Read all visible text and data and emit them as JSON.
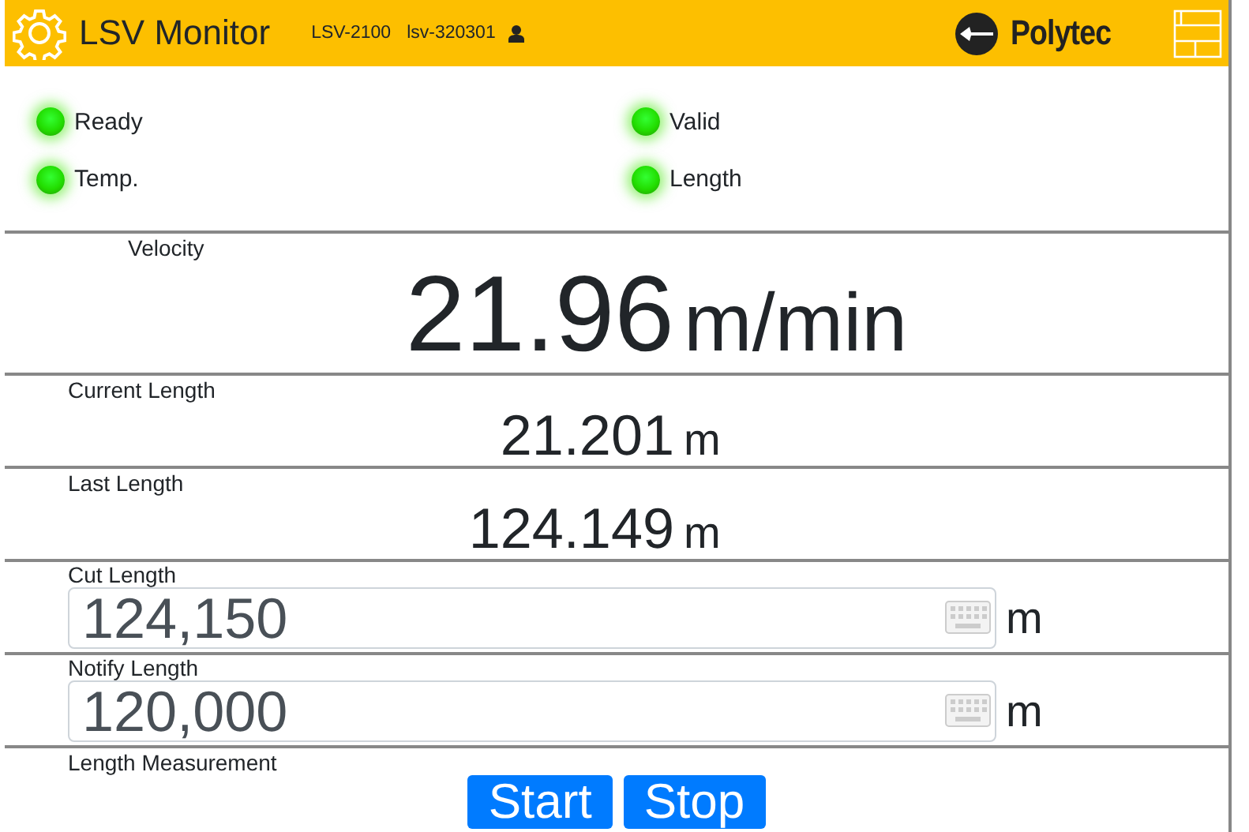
{
  "header": {
    "title": "LSV Monitor",
    "device": "LSV-2100",
    "serial": "lsv-320301",
    "brand": "Polytec"
  },
  "status_lamps": [
    {
      "label": "Ready",
      "on": true
    },
    {
      "label": "Valid",
      "on": true
    },
    {
      "label": "Temp.",
      "on": true
    },
    {
      "label": "Length",
      "on": true
    }
  ],
  "readings": [
    {
      "kind": "large",
      "label": "Velocity",
      "value": "21.96",
      "unit": "m/min"
    },
    {
      "kind": "normal",
      "label": "Current Length",
      "value": "21.201",
      "unit": "m"
    },
    {
      "kind": "normal",
      "label": "Last Length",
      "value": "124.149",
      "unit": "m"
    }
  ],
  "inputs": [
    {
      "label": "Cut Length",
      "value": "124,150",
      "unit": "m"
    },
    {
      "label": "Notify Length",
      "value": "120,000",
      "unit": "m"
    }
  ],
  "measurement": {
    "label": "Length Measurement",
    "buttons": [
      "Start",
      "Stop"
    ]
  }
}
